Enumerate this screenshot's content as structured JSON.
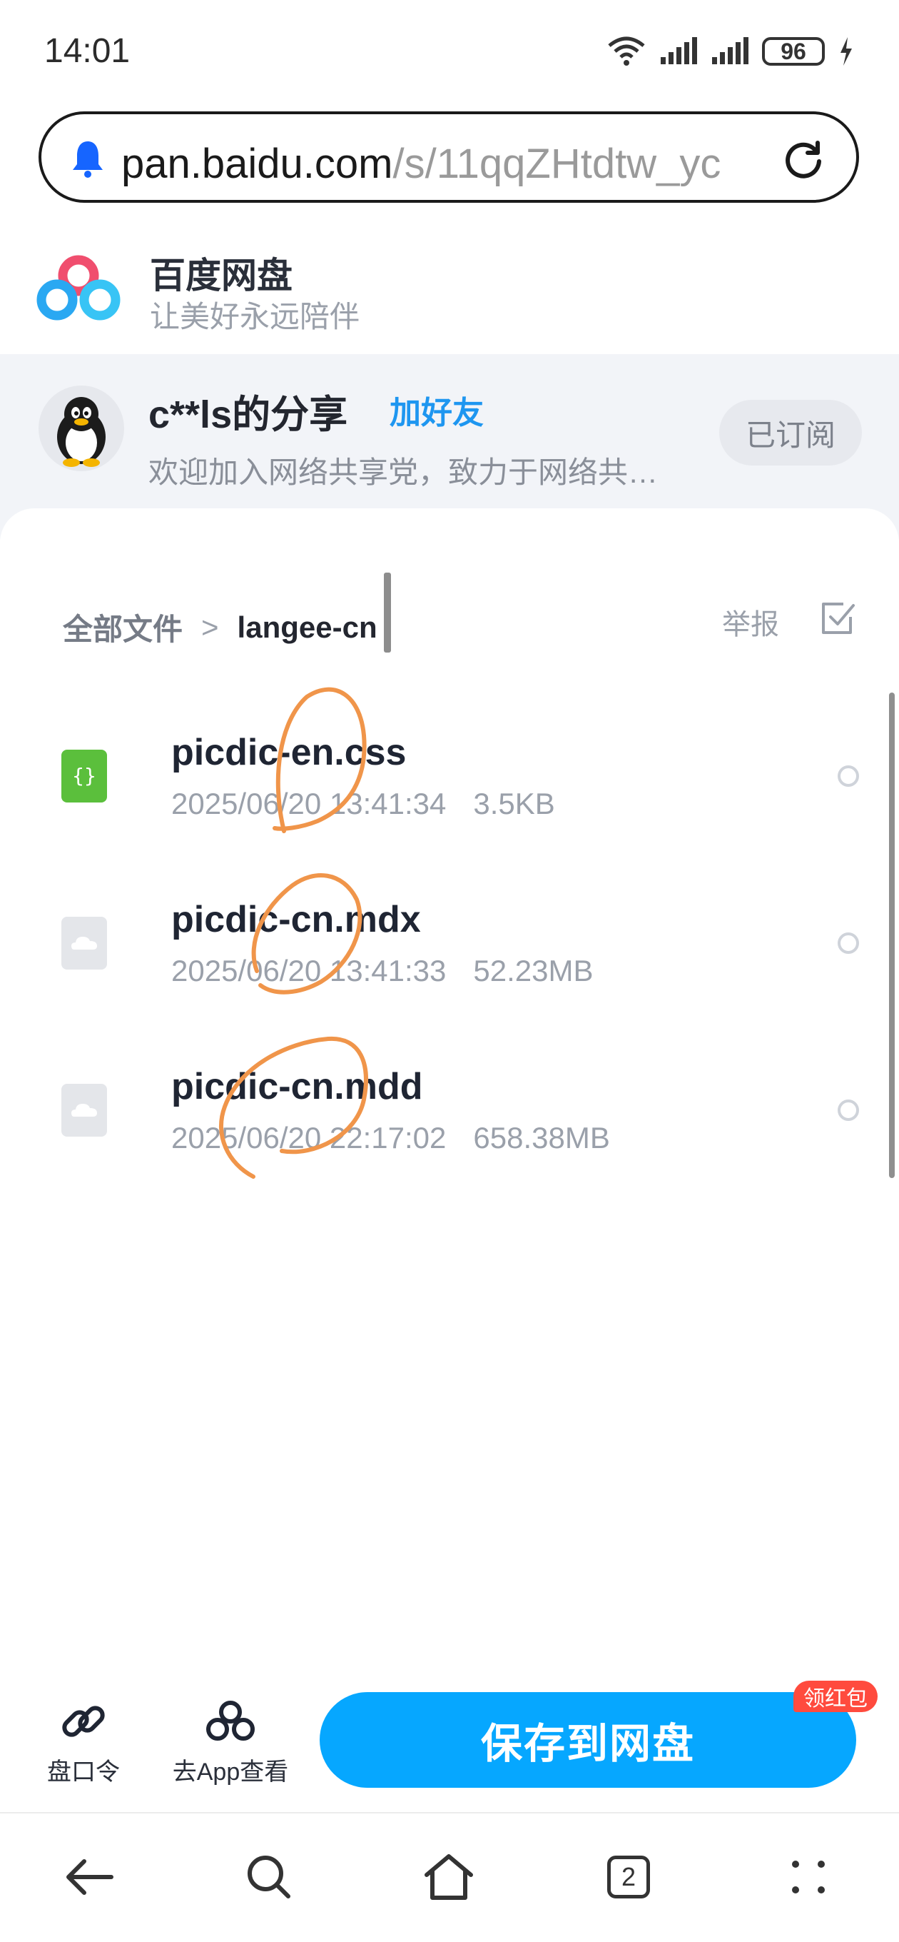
{
  "status_bar": {
    "time": "14:01",
    "battery": "96"
  },
  "browser": {
    "url_host": "pan.baidu.com",
    "url_path": "/s/11qqZHtdtw_yc",
    "reload_icon": "reload-icon"
  },
  "header": {
    "brand_name": "百度网盘",
    "brand_slogan": "让美好永远陪伴"
  },
  "sharer": {
    "name": "c**ls的分享",
    "add_friend": "加好友",
    "description": "欢迎加入网络共享党，致力于网络共享资源…",
    "subscribe_label": "已订阅"
  },
  "breadcrumb": {
    "root": "全部文件",
    "separator": ">",
    "current": "langee-cn"
  },
  "toolbar": {
    "report": "举报"
  },
  "files": [
    {
      "name": "picdic-en.css",
      "date": "2025/06/20 13:41:34",
      "size": "3.5KB",
      "icon": "css-file-icon",
      "icon_color": "#5bbf3c"
    },
    {
      "name": "picdic-cn.mdx",
      "date": "2025/06/20 13:41:33",
      "size": "52.23MB",
      "icon": "generic-file-icon",
      "icon_color": "#e4e6ea"
    },
    {
      "name": "picdic-cn.mdd",
      "date": "2025/06/20 22:17:02",
      "size": "658.38MB",
      "icon": "generic-file-icon",
      "icon_color": "#e4e6ea"
    }
  ],
  "actions": {
    "share_code": "盘口令",
    "open_app": "去App查看",
    "save": "保存到网盘",
    "red_packet": "领红包"
  },
  "nav": {
    "tabs_count": "2"
  },
  "colors": {
    "accent": "#06a7ff",
    "link": "#1e96f0",
    "badge": "#ff4b3e",
    "annotation": "#f0954a"
  }
}
